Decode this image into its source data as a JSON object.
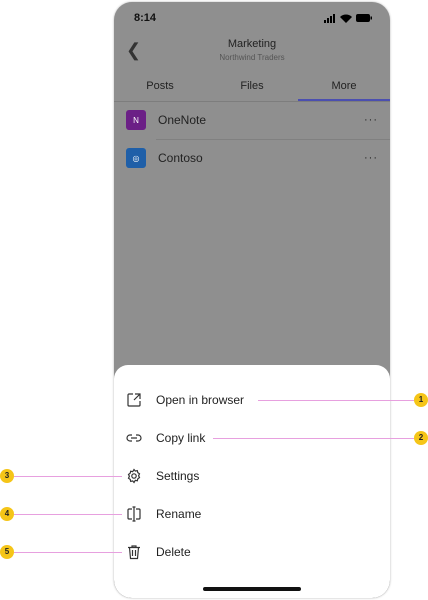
{
  "status": {
    "time": "8:14"
  },
  "header": {
    "title": "Marketing",
    "subtitle": "Northwind Traders"
  },
  "tabs": [
    {
      "label": "Posts"
    },
    {
      "label": "Files"
    },
    {
      "label": "More",
      "active": true
    }
  ],
  "apps": [
    {
      "name": "OneNote",
      "color": "#6b1f86",
      "icon": "onenote-icon"
    },
    {
      "name": "Contoso",
      "color": "#1f5fa8",
      "icon": "contoso-icon"
    }
  ],
  "menu": [
    {
      "label": "Open in browser",
      "icon": "open-external-icon",
      "callout": "1"
    },
    {
      "label": "Copy link",
      "icon": "link-icon",
      "callout": "2"
    },
    {
      "label": "Settings",
      "icon": "gear-icon",
      "callout": "3"
    },
    {
      "label": "Rename",
      "icon": "rename-icon",
      "callout": "4"
    },
    {
      "label": "Delete",
      "icon": "trash-icon",
      "callout": "5"
    }
  ],
  "colors": {
    "overlay": "#8f8f8f",
    "accent": "#4b4fb0",
    "callout_line": "#e7a0df",
    "badge": "#f5c518"
  }
}
